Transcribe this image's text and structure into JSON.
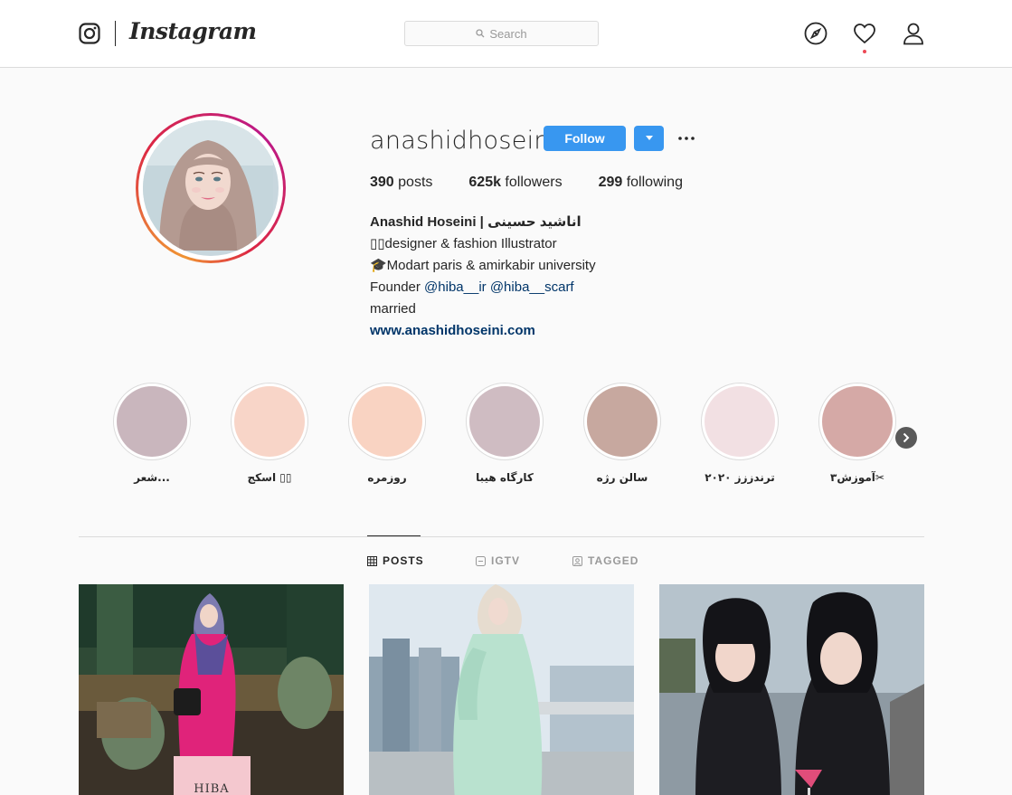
{
  "nav": {
    "wordmark": "Instagram",
    "search_placeholder": "Search"
  },
  "profile": {
    "username": "anashidhoseini",
    "follow_label": "Follow",
    "stats": [
      {
        "num": "390",
        "label": " posts"
      },
      {
        "num": "625k",
        "label": " followers"
      },
      {
        "num": "299",
        "label": " following"
      }
    ],
    "bio": {
      "name": "Anashid Hoseini | اناشید حسینی",
      "line1": "▯▯designer & fashion Illustrator",
      "line2": "🎓Modart paris & amirkabir university",
      "founder_prefix": "Founder ",
      "mention1": "@hiba__ir",
      "mention2": "@hiba__scarf",
      "line4": "married",
      "url": "www.anashidhoseini.com"
    }
  },
  "highlights": [
    {
      "label": "...شعر",
      "color": "#c9b6bd"
    },
    {
      "label": "▯▯ اسکج",
      "color": "#f8d5c8"
    },
    {
      "label": "روزمره",
      "color": "#f9d3c2"
    },
    {
      "label": "کارگاه هیبا",
      "color": "#cfbcc2"
    },
    {
      "label": "سالن رژه",
      "color": "#c7a89f"
    },
    {
      "label": "ترندززز ۲۰۲۰",
      "color": "#f2e0e3"
    },
    {
      "label": "✂آموزش۳",
      "color": "#d5a9a6"
    }
  ],
  "tabs": [
    {
      "label": "POSTS",
      "active": true
    },
    {
      "label": "IGTV",
      "active": false
    },
    {
      "label": "TAGGED",
      "active": false
    }
  ],
  "posts": [
    {
      "sign_text": "HIBA"
    },
    {
      "sign_text": ""
    },
    {
      "sign_text": ""
    }
  ]
}
